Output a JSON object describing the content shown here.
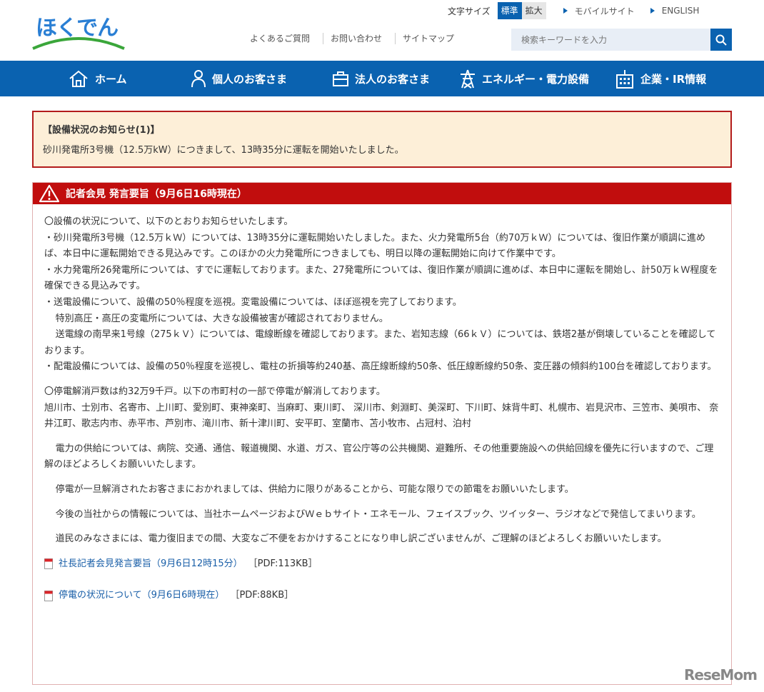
{
  "header": {
    "logo_text": "ほくでん",
    "font_size_label": "文字サイズ",
    "font_size_standard": "標準",
    "font_size_large": "拡大",
    "mobile_site": "モバイルサイト",
    "english": "ENGLISH",
    "faq": "よくあるご質問",
    "contact": "お問い合わせ",
    "sitemap": "サイトマップ",
    "search_placeholder": "検索キーワードを入力"
  },
  "nav": {
    "home": "ホーム",
    "personal": "個人のお客さま",
    "business": "法人のお客さま",
    "energy": "エネルギー・電力設備",
    "corporate": "企業・IR情報"
  },
  "notice": {
    "title": "【設備状況のお知らせ(1)】",
    "body": "砂川発電所3号機（12.5万kW）につきまして、13時35分に運転を開始いたしました。"
  },
  "press": {
    "title": "記者会見 発言要旨（9月6日16時現在）",
    "lines": [
      "〇設備の状況について、以下のとおりお知らせいたします。",
      "・砂川発電所3号機（12.5万ｋＷ）については、13時35分に運転開始いたしました。また、火力発電所5台（約70万ｋＷ）については、復旧作業が順調に進めば、本日中に運転開始できる見込みです。このほかの火力発電所につきましても、明日以降の運転開始に向けて作業中です。",
      "・水力発電所26発電所については、すでに運転しております。また、27発電所については、復旧作業が順調に進めば、本日中に運転を開始し、計50万ｋＷ程度を確保できる見込みです。",
      "・送電設備について、設備の50％程度を巡視。変電設備については、ほぼ巡視を完了しております。",
      "特別高圧・高圧の変電所については、大きな設備被害が確認されておりません。",
      "送電線の南早来1号線（275ｋＶ）については、電線断線を確認しております。また、岩知志線（66ｋＶ）については、鉄塔2基が倒壊していることを確認しております。",
      "・配電設備については、設備の50％程度を巡視し、電柱の折損等約240基、高圧線断線約50条、低圧線断線約50条、変圧器の傾斜約100台を確認しております。"
    ],
    "restore_title": "〇停電解消戸数は約32万9千戸。以下の市町村の一部で停電が解消しております。",
    "restore_list": "旭川市、士別市、名寄市、上川町、愛別町、東神楽町、当麻町、東川町、 深川市、剣淵町、美深町、下川町、妹背牛町、札幌市、岩見沢市、三笠市、美唄市、 奈井江町、歌志内市、赤平市、芦別市、滝川市、新十津川町、安平町、室蘭市、苫小牧市、占冠村、泊村",
    "para1": "電力の供給については、病院、交通、通信、報道機関、水道、ガス、官公庁等の公共機関、避難所、その他重要施設への供給回線を優先に行いますので、ご理解のほどよろしくお願いいたします。",
    "para2": "停電が一旦解消されたお客さまにおかれましては、供給力に限りがあることから、可能な限りでの節電をお願いいたします。",
    "para3": "今後の当社からの情報については、当社ホームページおよびＷｅｂサイト・エネモール、フェイスブック、ツイッター、ラジオなどで発信してまいります。",
    "para4": "道民のみなさまには、電力復旧までの間、大変なご不便をおかけすることになり申し訳ございませんが、ご理解のほどよろしくお願いいたします。",
    "pdf1_label": "社長記者会見発言要旨（9月6日12時15分）",
    "pdf1_size": "［PDF:113KB］",
    "pdf2_label": "停電の状況について（9月6日6時現在）",
    "pdf2_size": "［PDF:88KB］"
  },
  "watermark": "ReseMom",
  "colors": {
    "brand_blue": "#0a62b0",
    "alert_red": "#c10d0d",
    "notice_bg": "#fdefd8"
  }
}
